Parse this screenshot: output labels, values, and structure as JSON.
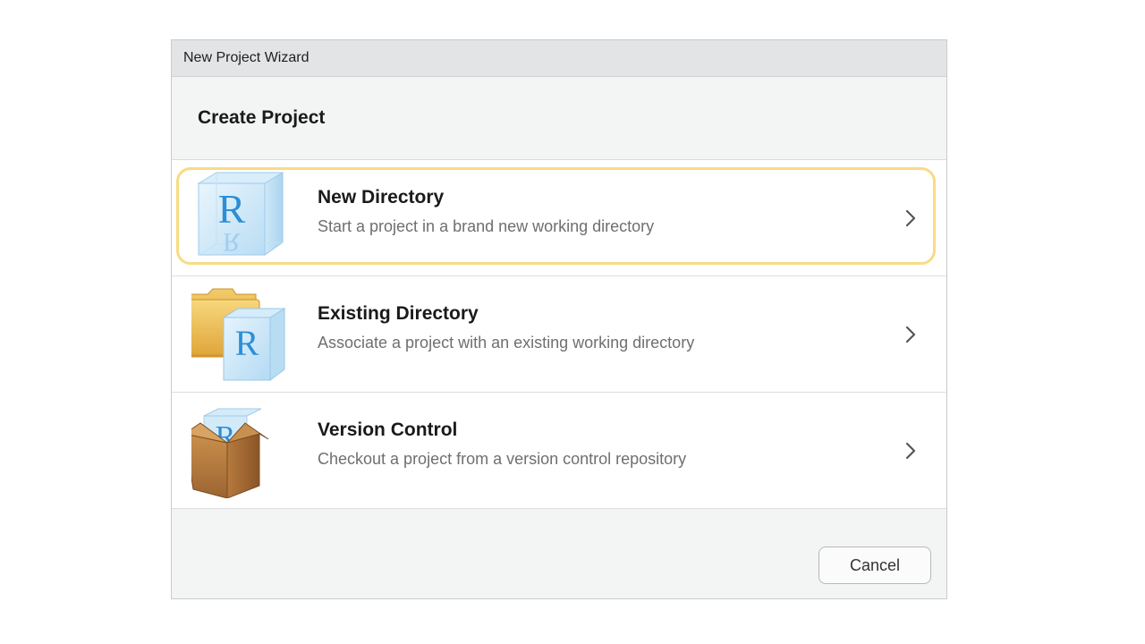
{
  "window": {
    "title": "New Project Wizard"
  },
  "heading": "Create Project",
  "options": [
    {
      "title": "New Directory",
      "description": "Start a project in a brand new working directory",
      "icon": "r-cube-icon",
      "selected": true
    },
    {
      "title": "Existing Directory",
      "description": "Associate a project with an existing working directory",
      "icon": "folder-r-icon",
      "selected": false
    },
    {
      "title": "Version Control",
      "description": "Checkout a project from a version control repository",
      "icon": "box-r-icon",
      "selected": false
    }
  ],
  "footer": {
    "cancel_label": "Cancel"
  },
  "colors": {
    "highlight": "#f8dc82",
    "r_blue": "#2b8fd6",
    "folder": "#e8b447",
    "box": "#b57b3c"
  }
}
